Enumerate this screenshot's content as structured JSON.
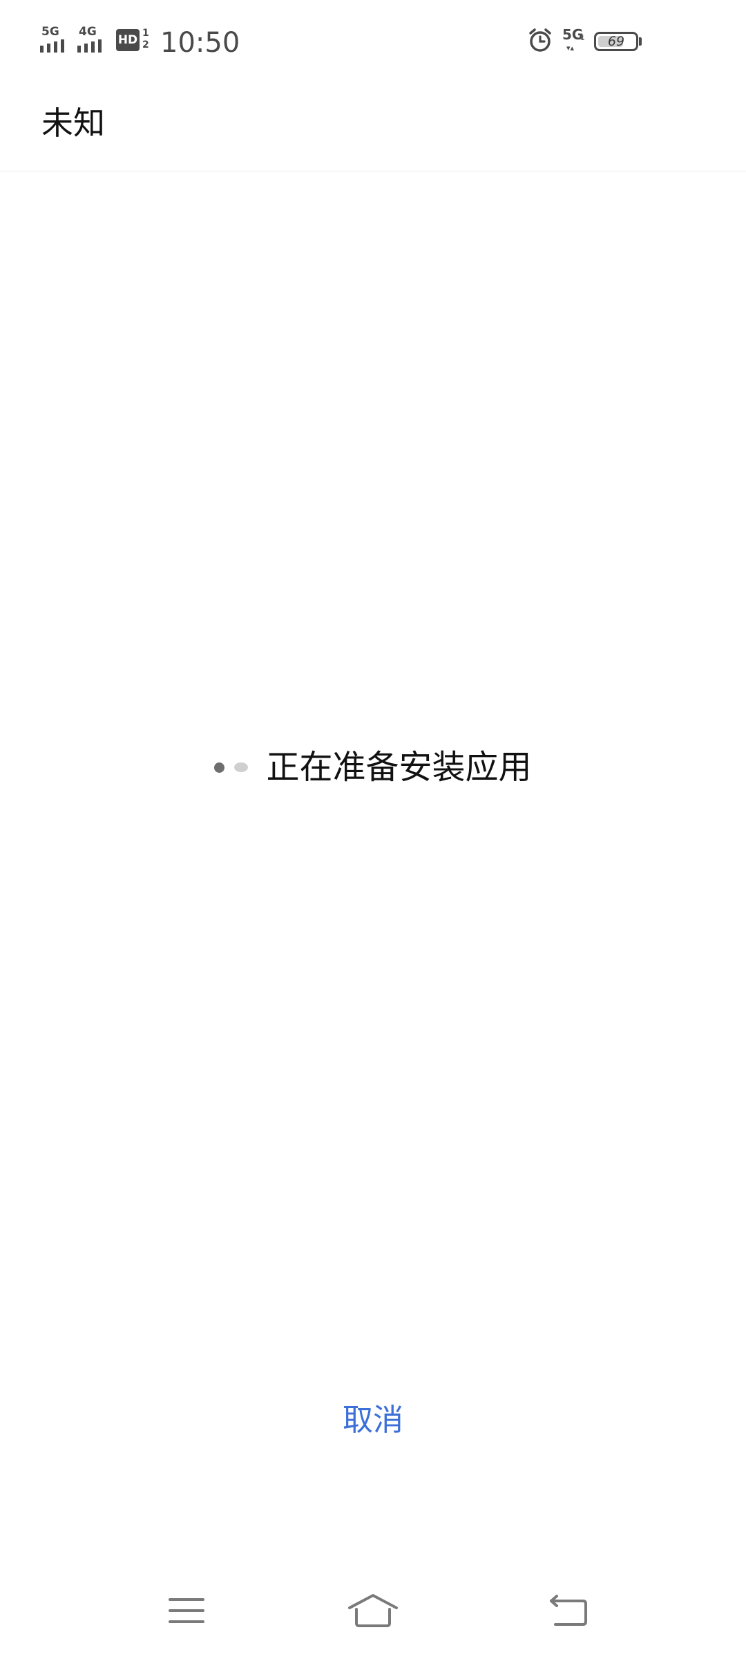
{
  "status_bar": {
    "sim1_network": "5G",
    "sim2_network": "4G",
    "hd_label": "HD",
    "hd_sub": "1\n2",
    "time": "10:50",
    "data_network": "5G",
    "data_sub": "1",
    "data_arrows": "▾▴",
    "battery_level": "69",
    "battery_fraction": 0.69
  },
  "header": {
    "title": "未知"
  },
  "loading": {
    "message": "正在准备安装应用"
  },
  "actions": {
    "cancel_label": "取消"
  },
  "colors": {
    "accent": "#3c6fd8",
    "status_icons": "#4a4a4a",
    "text": "#111111",
    "background": "#ffffff"
  },
  "nav_bar": {
    "icons": [
      "menu-icon",
      "home-icon",
      "back-icon"
    ]
  }
}
